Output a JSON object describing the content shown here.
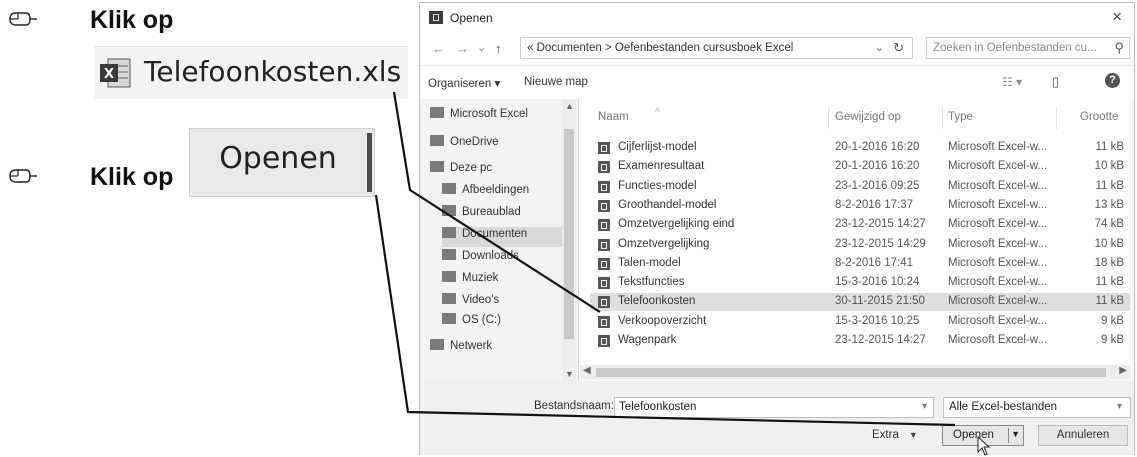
{
  "instructions": {
    "step1_label": "Klik op",
    "step1_file": "Telefoonkosten.xls",
    "step2_label": "Klik op",
    "step2_button": "Openen"
  },
  "dialog": {
    "title": "Openen",
    "close_glyph": "×",
    "nav": {
      "back": "←",
      "forward": "→",
      "recent": "⌄",
      "up": "↑"
    },
    "address_path": "« Documenten  >  Oefenbestanden cursusboek Excel",
    "address_caret": "⌄",
    "refresh": "↻",
    "search_placeholder": "Zoeken in Oefenbestanden cu...",
    "search_icon": "⚲",
    "toolbar": {
      "organize": "Organiseren ▾",
      "new_folder": "Nieuwe map",
      "view_icon": "☷ ▾",
      "pane_icon": "▯",
      "help": "?"
    },
    "nav_pane": [
      {
        "label": "Microsoft Excel",
        "icon": "excel-icon",
        "selected": false
      },
      {
        "label": "OneDrive",
        "icon": "cloud-icon",
        "selected": false
      },
      {
        "label": "Deze pc",
        "icon": "computer-icon",
        "selected": false
      },
      {
        "label": "Afbeeldingen",
        "icon": "pictures-folder-icon",
        "selected": false
      },
      {
        "label": "Bureaublad",
        "icon": "desktop-folder-icon",
        "selected": false
      },
      {
        "label": "Documenten",
        "icon": "documents-folder-icon",
        "selected": true
      },
      {
        "label": "Downloads",
        "icon": "downloads-folder-icon",
        "selected": false
      },
      {
        "label": "Muziek",
        "icon": "music-folder-icon",
        "selected": false
      },
      {
        "label": "Video's",
        "icon": "video-folder-icon",
        "selected": false
      },
      {
        "label": "OS (C:)",
        "icon": "drive-icon",
        "selected": false
      },
      {
        "label": "Netwerk",
        "icon": "network-icon",
        "selected": false
      }
    ],
    "columns": {
      "name": "Naam",
      "modified": "Gewijzigd op",
      "type": "Type",
      "size": "Grootte"
    },
    "files": [
      {
        "name": "Cijferlijst-model",
        "modified": "20-1-2016 16:20",
        "type": "Microsoft Excel-w...",
        "size": "11 kB",
        "selected": false
      },
      {
        "name": "Examenresultaat",
        "modified": "20-1-2016 16:20",
        "type": "Microsoft Excel-w...",
        "size": "10 kB",
        "selected": false
      },
      {
        "name": "Functies-model",
        "modified": "23-1-2016 09:25",
        "type": "Microsoft Excel-w...",
        "size": "11 kB",
        "selected": false
      },
      {
        "name": "Groothandel-model",
        "modified": "8-2-2016 17:37",
        "type": "Microsoft Excel-w...",
        "size": "13 kB",
        "selected": false
      },
      {
        "name": "Omzetvergelijking eind",
        "modified": "23-12-2015 14:27",
        "type": "Microsoft Excel-w...",
        "size": "74 kB",
        "selected": false
      },
      {
        "name": "Omzetvergelijking",
        "modified": "23-12-2015 14:29",
        "type": "Microsoft Excel-w...",
        "size": "10 kB",
        "selected": false
      },
      {
        "name": "Talen-model",
        "modified": "8-2-2016 17:41",
        "type": "Microsoft Excel-w...",
        "size": "18 kB",
        "selected": false
      },
      {
        "name": "Tekstfuncties",
        "modified": "15-3-2016 10:24",
        "type": "Microsoft Excel-w...",
        "size": "11 kB",
        "selected": false
      },
      {
        "name": "Telefoonkosten",
        "modified": "30-11-2015 21:50",
        "type": "Microsoft Excel-w...",
        "size": "11 kB",
        "selected": true
      },
      {
        "name": "Verkoopoverzicht",
        "modified": "15-3-2016 10:25",
        "type": "Microsoft Excel-w...",
        "size": "9 kB",
        "selected": false
      },
      {
        "name": "Wagenpark",
        "modified": "23-12-2015 14:27",
        "type": "Microsoft Excel-w...",
        "size": "9 kB",
        "selected": false
      }
    ],
    "filename_label": "Bestandsnaam:",
    "filename_value": "Telefoonkosten",
    "filter_value": "Alle Excel-bestanden",
    "extra_label": "Extra",
    "open_label": "Openen",
    "cancel_label": "Annuleren"
  }
}
